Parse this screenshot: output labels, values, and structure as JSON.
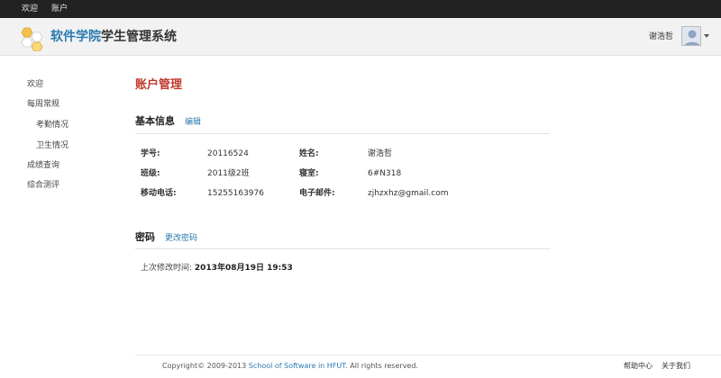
{
  "topbar": {
    "items": [
      {
        "label": "欢迎"
      },
      {
        "label": "账户"
      }
    ]
  },
  "header": {
    "brand_highlight": "软件学院",
    "brand_rest": "学生管理系统",
    "username": "谢浩哲"
  },
  "sidebar": {
    "items": [
      {
        "label": "欢迎"
      },
      {
        "label": "每周常规"
      },
      {
        "label": "考勤情况"
      },
      {
        "label": "卫生情况"
      },
      {
        "label": "成绩查询"
      },
      {
        "label": "综合测评"
      }
    ]
  },
  "main": {
    "title": "账户管理",
    "basic": {
      "title": "基本信息",
      "edit_link": "编辑",
      "fields": [
        {
          "label": "学号:",
          "value": "20116524"
        },
        {
          "label": "姓名:",
          "value": "谢浩哲"
        },
        {
          "label": "班级:",
          "value": "2011级2班"
        },
        {
          "label": "寝室:",
          "value": "6#N318"
        },
        {
          "label": "移动电话:",
          "value": "15255163976"
        },
        {
          "label": "电子邮件:",
          "value": "zjhzxhz@gmail.com"
        }
      ]
    },
    "password": {
      "title": "密码",
      "change_link": "更改密码",
      "last_modified_label": "上次修改时间:",
      "last_modified_value": "2013年08月19日 19:53"
    }
  },
  "footer": {
    "copyright_prefix": "Copyright© 2009-2013",
    "org": "School of Software in HFUT",
    "copyright_suffix": ". All rights reserved.",
    "links": [
      {
        "label": "帮助中心"
      },
      {
        "label": "关于我们"
      }
    ]
  },
  "colors": {
    "topbar": "#222222",
    "accent_red": "#c0392b",
    "link_blue": "#2a7ab0"
  }
}
